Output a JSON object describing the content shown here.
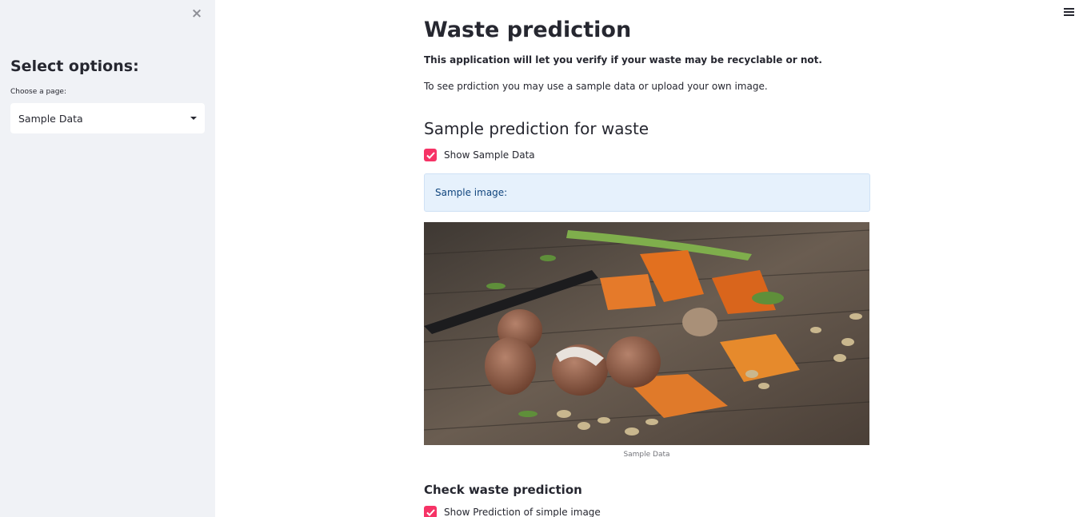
{
  "sidebar": {
    "close_icon": "×",
    "title": "Select options:",
    "select_label": "Choose a page:",
    "select_value": "Sample Data"
  },
  "header": {
    "menu_icon": "hamburger-icon"
  },
  "main": {
    "title": "Waste prediction",
    "intro_bold": "This application will let you verify if your waste may be recyclable or not.",
    "intro": "To see prdiction you may use a sample data or upload your own image.",
    "section_title": "Sample prediction for waste",
    "show_sample_checkbox": {
      "label": "Show Sample Data",
      "checked": true
    },
    "info_text": "Sample image:",
    "image_caption": "Sample Data",
    "check_title": "Check waste prediction",
    "show_prediction_checkbox": {
      "label": "Show Prediction of simple image",
      "checked": true
    }
  },
  "colors": {
    "accent": "#f63366",
    "sidebar_bg": "#f0f2f6",
    "info_bg": "#e6f1fc",
    "info_text": "#10457e"
  }
}
